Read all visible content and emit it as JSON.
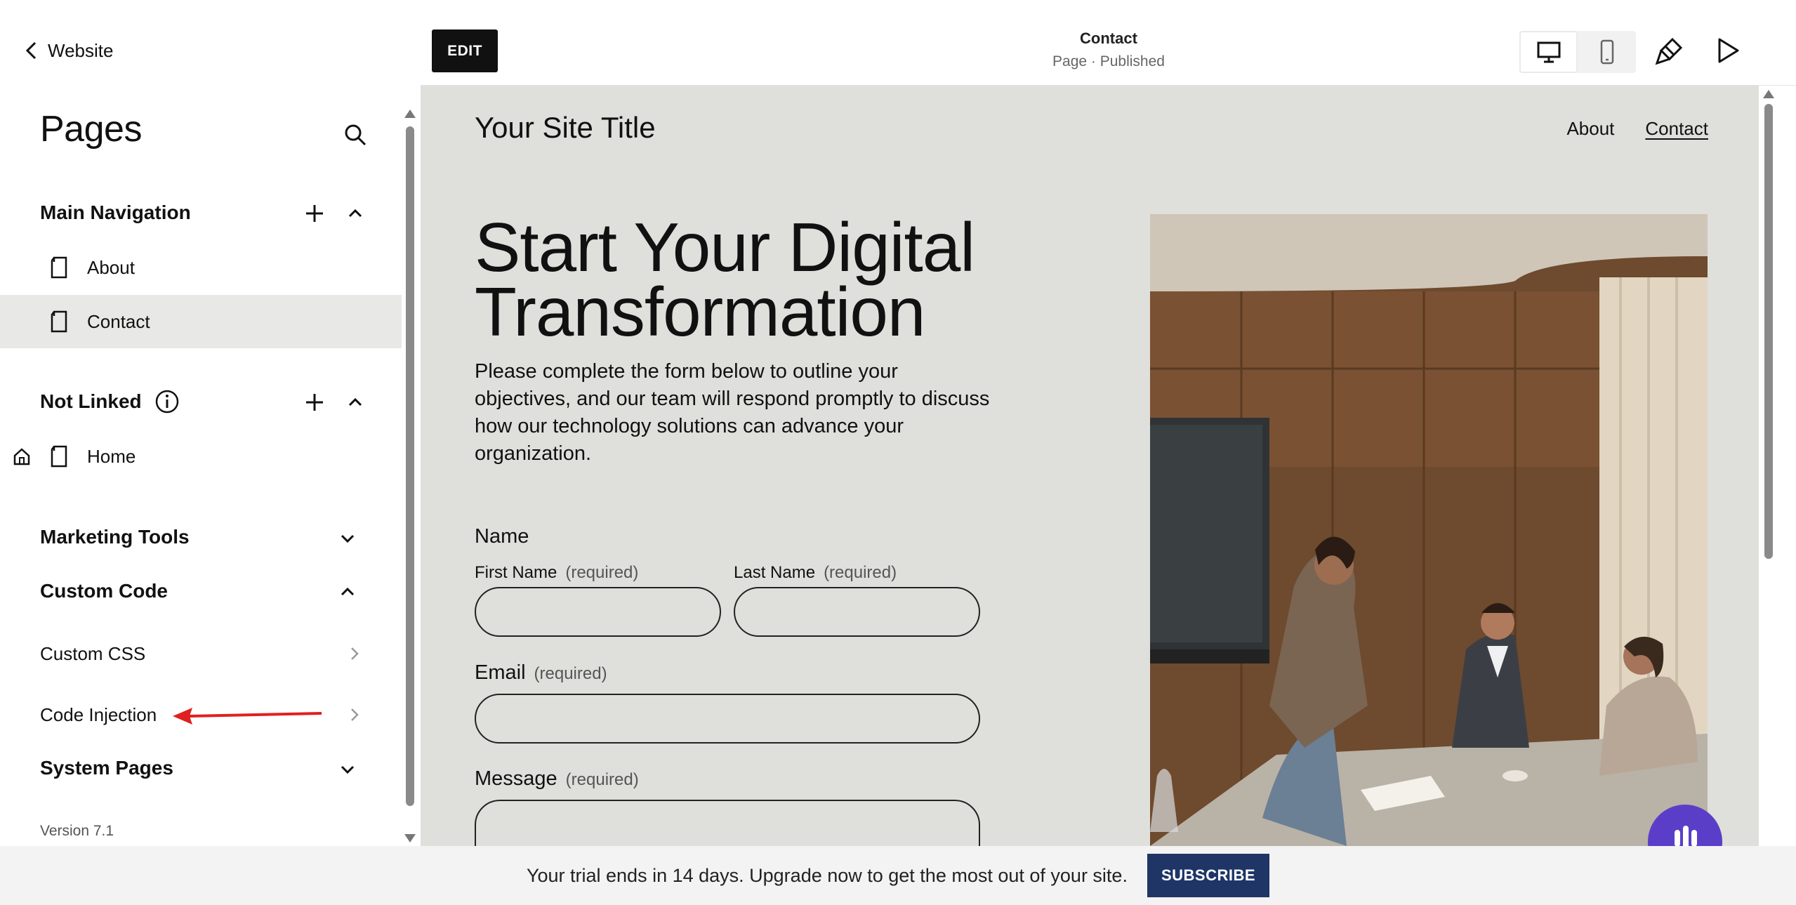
{
  "sidebar": {
    "back_label": "Website",
    "title": "Pages",
    "sections": {
      "main_navigation": {
        "label": "Main Navigation",
        "items": [
          {
            "label": "About"
          },
          {
            "label": "Contact"
          }
        ]
      },
      "not_linked": {
        "label": "Not Linked",
        "items": [
          {
            "label": "Home"
          }
        ]
      },
      "marketing_tools": {
        "label": "Marketing Tools"
      },
      "custom_code": {
        "label": "Custom Code",
        "items": [
          {
            "label": "Custom CSS"
          },
          {
            "label": "Code Injection"
          }
        ]
      },
      "system_pages": {
        "label": "System Pages"
      }
    },
    "version": "Version 7.1"
  },
  "toolbar": {
    "edit_label": "EDIT",
    "page_title": "Contact",
    "page_status": "Page · Published"
  },
  "site": {
    "title": "Your Site Title",
    "nav": [
      {
        "label": "About"
      },
      {
        "label": "Contact"
      }
    ],
    "hero_title": "Start Your Digital Transformation",
    "hero_description": "Please complete the form below to outline your objectives, and our team will respond promptly to discuss how our technology solutions can advance your organization.",
    "form": {
      "name_label": "Name",
      "first_name_label": "First Name",
      "last_name_label": "Last Name",
      "email_label": "Email",
      "message_label": "Message",
      "required_text": "(required)"
    }
  },
  "trial_banner": {
    "message": "Your trial ends in 14 days. Upgrade now to get the most out of your site.",
    "button": "SUBSCRIBE"
  },
  "colors": {
    "accent_dark": "#111111",
    "site_background": "#dfdfdb",
    "subscribe_button": "#1e3566",
    "chat_bubble": "#5b3ec8",
    "annotation_arrow": "#e02020"
  },
  "icons": [
    "chevron-left-icon",
    "search-icon",
    "plus-icon",
    "chevron-up-icon",
    "chevron-down-icon",
    "page-icon",
    "home-icon",
    "info-icon",
    "chevron-right-icon",
    "desktop-icon",
    "mobile-icon",
    "design-brush-icon",
    "play-preview-icon",
    "chat-icon"
  ]
}
